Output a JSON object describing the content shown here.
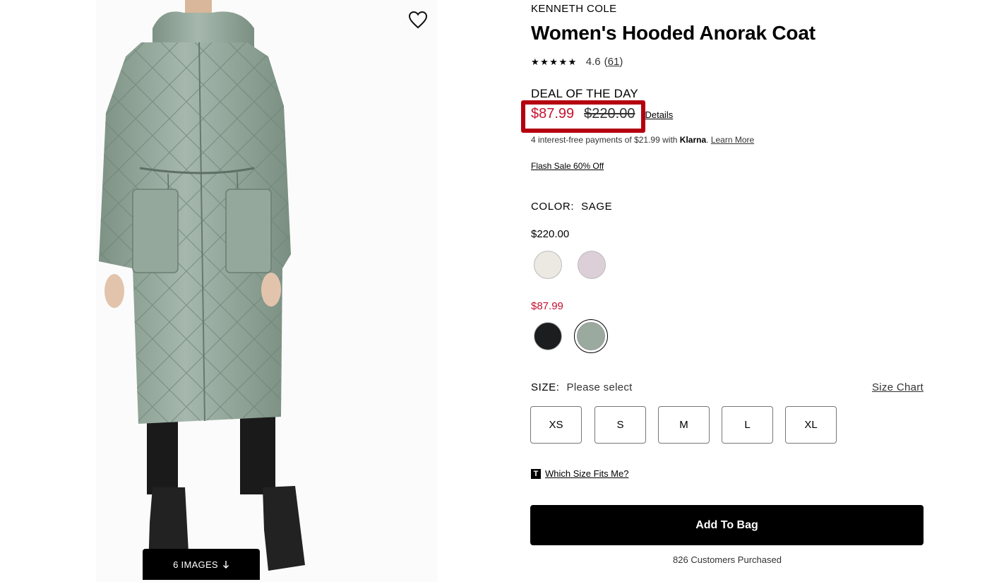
{
  "gallery": {
    "images_button_label": "6 IMAGES",
    "images_button_icon": "arrow-down-icon",
    "wishlist_icon": "heart-icon"
  },
  "product": {
    "brand": "KENNETH COLE",
    "title": "Women's Hooded Anorak Coat",
    "rating": {
      "stars_value": 4.6,
      "stars_display": "★★★★★",
      "value_text": "4.6",
      "count_open": "(",
      "count": "61",
      "count_close": ")"
    },
    "deal_label": "DEAL OF THE DAY",
    "sale_price": "$87.99",
    "original_price": "$220.00",
    "details_link": "Details",
    "klarna": {
      "text": "4 interest-free payments of $21.99 with ",
      "brand": "Klarna",
      "period": ". ",
      "learn_more": "Learn More"
    },
    "flash_sale": "Flash Sale 60% Off",
    "color": {
      "label": "COLOR:",
      "selected": "SAGE",
      "groups": [
        {
          "price": "$220.00",
          "swatches": [
            {
              "name": "cream",
              "hex": "#ece9e3"
            },
            {
              "name": "lilac",
              "hex": "#dccfd8"
            }
          ]
        },
        {
          "price": "$87.99",
          "swatches": [
            {
              "name": "black",
              "hex": "#1c1d1f"
            },
            {
              "name": "sage",
              "hex": "#9aaa9f",
              "selected": true
            }
          ]
        }
      ]
    },
    "size": {
      "label": "SIZE:",
      "value": "Please select",
      "chart_link": "Size Chart",
      "options": [
        "XS",
        "S",
        "M",
        "L",
        "XL"
      ]
    },
    "fit": {
      "icon_letter": "T",
      "link": "Which Size Fits Me?"
    },
    "add_to_bag": "Add To Bag",
    "purchased_text": "826 Customers Purchased"
  },
  "colors": {
    "sale_red": "#c4122f",
    "highlight_red": "#b5000f",
    "coat_sage": "#8fa397"
  }
}
